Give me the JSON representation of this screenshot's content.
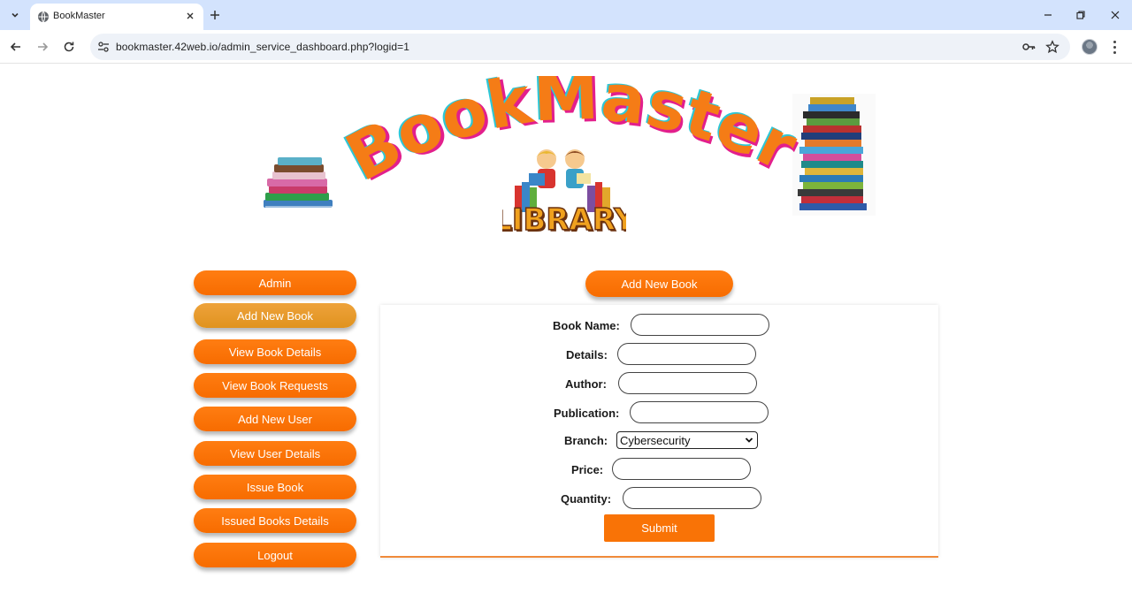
{
  "browser": {
    "tab_title": "BookMaster",
    "url": "bookmaster.42web.io/admin_service_dashboard.php?logid=1"
  },
  "banner": {
    "logo_text": "BookMaster",
    "sub_logo_text": "LIBRARY"
  },
  "sidebar": {
    "items": [
      {
        "label": "Admin"
      },
      {
        "label": "Add New Book"
      },
      {
        "label": "View Book Details"
      },
      {
        "label": "View Book Requests"
      },
      {
        "label": "Add New User"
      },
      {
        "label": "View User Details"
      },
      {
        "label": "Issue Book"
      },
      {
        "label": "Issued Books Details"
      },
      {
        "label": "Logout"
      }
    ]
  },
  "main": {
    "heading": "Add New Book",
    "form": {
      "book_name_label": "Book Name:",
      "details_label": "Details:",
      "author_label": "Author:",
      "publication_label": "Publication:",
      "branch_label": "Branch:",
      "branch_value": "Cybersecurity",
      "price_label": "Price:",
      "quantity_label": "Quantity:",
      "submit_label": "Submit"
    }
  },
  "colors": {
    "accent": "#f97306",
    "active_item": "#e69a2c",
    "chrome": "#d3e3fd"
  }
}
